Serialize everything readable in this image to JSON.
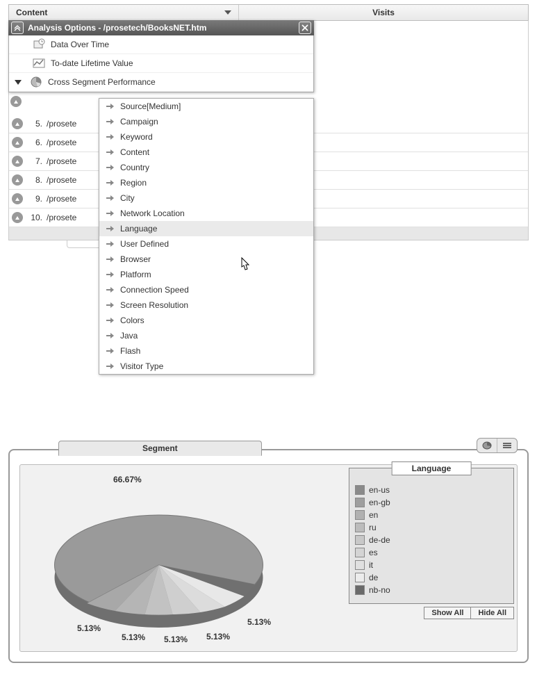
{
  "header": {
    "content_label": "Content",
    "visits_label": "Visits"
  },
  "rows": [
    {
      "idx": "5.",
      "path": "/prosete"
    },
    {
      "idx": "6.",
      "path": "/prosete"
    },
    {
      "idx": "7.",
      "path": "/prosete"
    },
    {
      "idx": "8.",
      "path": "/prosete"
    },
    {
      "idx": "9.",
      "path": "/prosete"
    },
    {
      "idx": "10.",
      "path": "/prosete"
    }
  ],
  "panel": {
    "title": "Analysis Options - /prosetech/BooksNET.htm",
    "options": {
      "data_over_time": "Data Over Time",
      "lifetime_value": "To-date Lifetime Value",
      "cross_segment": "Cross Segment Performance"
    },
    "submenu": [
      "Source[Medium]",
      "Campaign",
      "Keyword",
      "Content",
      "Country",
      "Region",
      "City",
      "Network Location",
      "Language",
      "User Defined",
      "Browser",
      "Platform",
      "Connection Speed",
      "Screen Resolution",
      "Colors",
      "Java",
      "Flash",
      "Visitor Type"
    ],
    "highlighted": "Language"
  },
  "chart": {
    "segment_tab": "Segment",
    "legend_title": "Language",
    "show_all": "Show All",
    "hide_all": "Hide All",
    "legend": [
      {
        "label": "en-us",
        "color": "#8a8a8a"
      },
      {
        "label": "en-gb",
        "color": "#9e9e9e"
      },
      {
        "label": "en",
        "color": "#b0b0b0"
      },
      {
        "label": "ru",
        "color": "#bcbcbc"
      },
      {
        "label": "de-de",
        "color": "#c8c8c8"
      },
      {
        "label": "es",
        "color": "#d4d4d4"
      },
      {
        "label": "it",
        "color": "#e0e0e0"
      },
      {
        "label": "de",
        "color": "#ececec"
      },
      {
        "label": "nb-no",
        "color": "#6a6a6a"
      }
    ],
    "labels": {
      "big": "66.67%",
      "s1": "5.13%",
      "s2": "5.13%",
      "s3": "5.13%",
      "s4": "5.13%",
      "s5": "5.13%"
    }
  },
  "chart_data": {
    "type": "pie",
    "title": "Segment",
    "dimension": "Language",
    "series": [
      {
        "name": "en-us",
        "value": 66.67
      },
      {
        "name": "en-gb",
        "value": 5.13
      },
      {
        "name": "en",
        "value": 5.13
      },
      {
        "name": "ru",
        "value": 5.13
      },
      {
        "name": "de-de",
        "value": 5.13
      },
      {
        "name": "es",
        "value": 5.13
      },
      {
        "name": "it",
        "value": 2.56
      },
      {
        "name": "de",
        "value": 2.56
      },
      {
        "name": "nb-no",
        "value": 2.56
      }
    ]
  }
}
